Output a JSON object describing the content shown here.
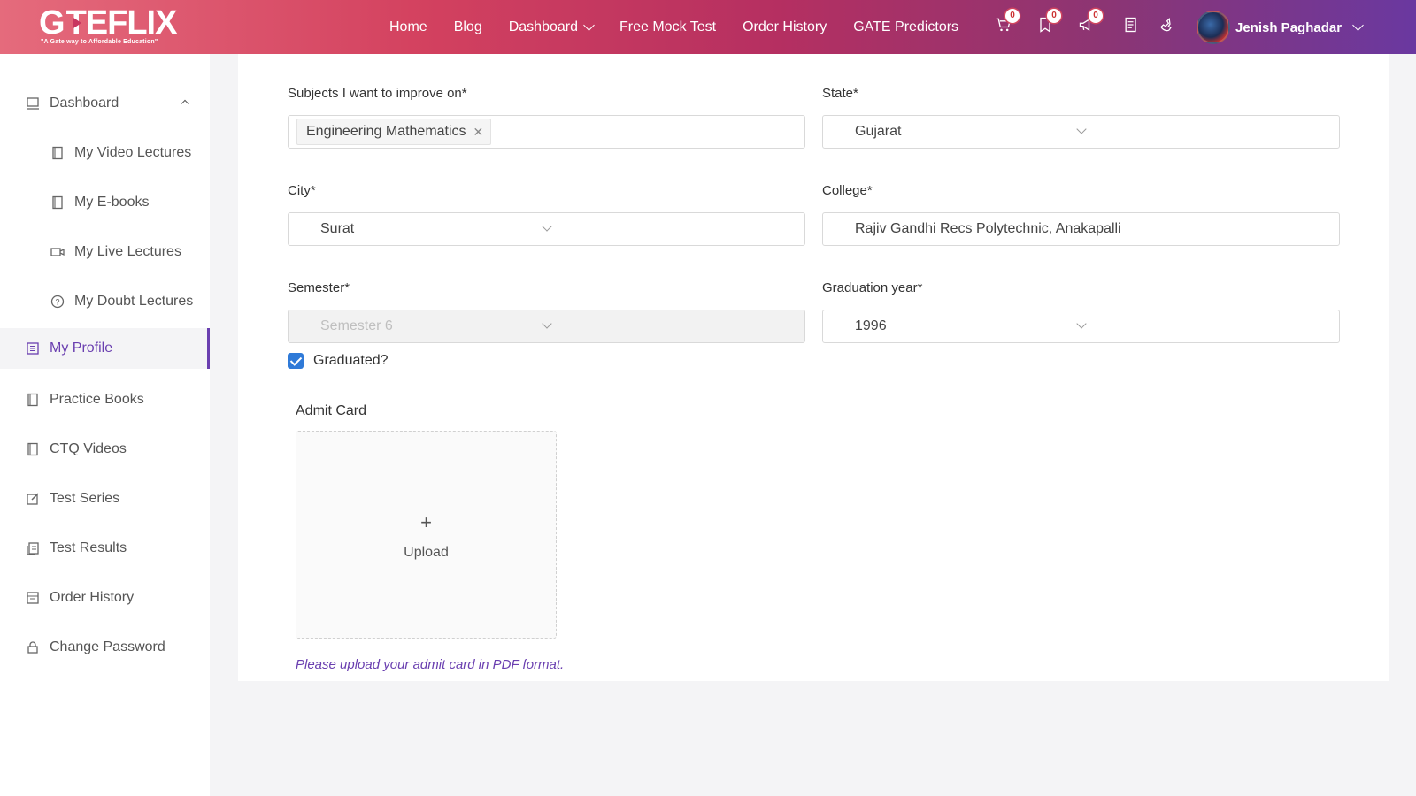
{
  "brand": {
    "logo_text_1": "G",
    "logo_text_2": "TEFLIX",
    "tagline": "\"A Gate way to Affordable Education\""
  },
  "nav": {
    "items": [
      {
        "label": "Home"
      },
      {
        "label": "Blog"
      },
      {
        "label": "Dashboard"
      },
      {
        "label": "Free Mock Test"
      },
      {
        "label": "Order History"
      },
      {
        "label": "GATE Predictors"
      }
    ],
    "cart_count": "0",
    "bookmark_count": "0",
    "notification_count": "0",
    "user_name": "Jenish Paghadar"
  },
  "sidebar": {
    "items": [
      {
        "label": "Dashboard",
        "icon": "laptop-icon"
      },
      {
        "label": "My Video Lectures",
        "icon": "book-icon"
      },
      {
        "label": "My E-books",
        "icon": "book-icon"
      },
      {
        "label": "My Live Lectures",
        "icon": "video-icon"
      },
      {
        "label": "My Doubt Lectures",
        "icon": "question-icon"
      },
      {
        "label": "My Profile",
        "icon": "profile-icon"
      },
      {
        "label": "Practice Books",
        "icon": "book-icon"
      },
      {
        "label": "CTQ Videos",
        "icon": "book-icon"
      },
      {
        "label": "Test Series",
        "icon": "edit-icon"
      },
      {
        "label": "Test Results",
        "icon": "file-icon"
      },
      {
        "label": "Order History",
        "icon": "receipt-icon"
      },
      {
        "label": "Change Password",
        "icon": "lock-icon"
      }
    ],
    "active": "My Profile"
  },
  "form": {
    "subjects_label": "Subjects I want to improve on*",
    "subjects_tag": "Engineering Mathematics",
    "state_label": "State*",
    "state_value": "Gujarat",
    "city_label": "City*",
    "city_value": "Surat",
    "college_label": "College*",
    "college_value": "Rajiv Gandhi Recs Polytechnic, Anakapalli",
    "semester_label": "Semester*",
    "semester_value": "Semester 6",
    "graduation_label": "Graduation year*",
    "graduation_value": "1996",
    "graduated_label": "Graduated?",
    "graduated_checked": true,
    "admit_card_label": "Admit Card",
    "upload_plus": "+",
    "upload_label": "Upload",
    "upload_hint": "Please upload your admit card in PDF format."
  },
  "colors": {
    "accent": "#6a3fb0",
    "header_start": "#e56b7c",
    "header_end": "#6a38a0",
    "checkbox": "#2f7ad8"
  }
}
